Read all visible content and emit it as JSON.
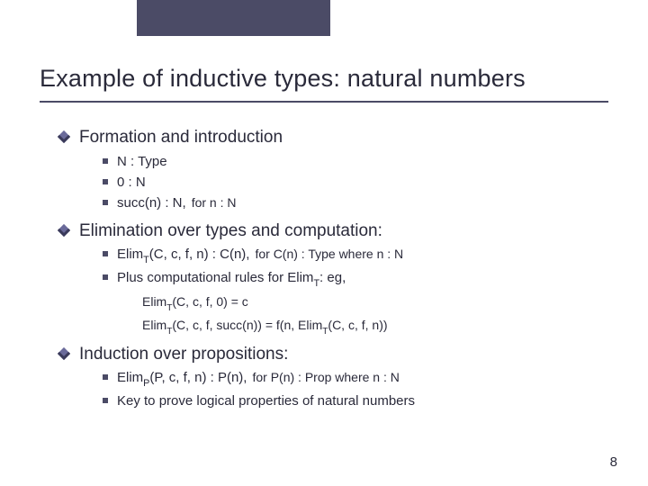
{
  "title": "Example of inductive types: natural numbers",
  "sections": [
    {
      "heading": "Formation and introduction",
      "items": [
        {
          "main": "N : Type",
          "note": ""
        },
        {
          "main": "0 : N",
          "note": ""
        },
        {
          "main": "succ(n) : N,",
          "note": "for n : N"
        }
      ],
      "sub": []
    },
    {
      "heading": "Elimination over types and computation:",
      "items": [
        {
          "main_html": "Elim<sub>T</sub>(C, c, f, n) : C(n),",
          "note": "for C(n) : Type where n : N"
        },
        {
          "main_html": "Plus computational rules for Elim<sub>T</sub>: eg,",
          "note": ""
        }
      ],
      "sub": [
        "Elim<sub>T</sub>(C, c, f, 0) = c",
        "Elim<sub>T</sub>(C, c, f, succ(n)) = f(n, Elim<sub>T</sub>(C, c, f, n))"
      ]
    },
    {
      "heading": "Induction over propositions:",
      "items": [
        {
          "main_html": "Elim<sub>P</sub>(P, c, f, n) : P(n),",
          "note": "for P(n) : Prop where n : N"
        },
        {
          "main": "Key to prove logical properties of natural numbers",
          "note": ""
        }
      ],
      "sub": []
    }
  ],
  "page_number": "8"
}
